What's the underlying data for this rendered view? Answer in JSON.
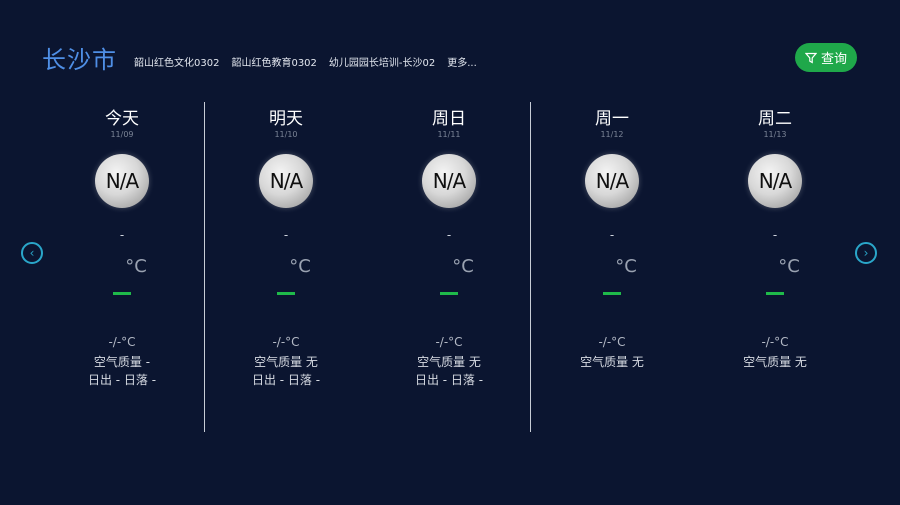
{
  "header": {
    "city": "长沙市",
    "tags": [
      "韶山红色文化0302",
      "韶山红色教育0302",
      "幼儿园园长培训-长沙02",
      "更多..."
    ],
    "query_label": "查询"
  },
  "nav": {
    "prev": "‹",
    "next": "›"
  },
  "days": [
    {
      "name": "今天",
      "date": "11/09",
      "icon": "N/A",
      "weather": "-",
      "temp_unit": "°C",
      "range": "-/-°C",
      "aqi": "空气质量 -",
      "sun": "日出 - 日落 -"
    },
    {
      "name": "明天",
      "date": "11/10",
      "icon": "N/A",
      "weather": "-",
      "temp_unit": "°C",
      "range": "-/-°C",
      "aqi": "空气质量 无",
      "sun": "日出 - 日落 -"
    },
    {
      "name": "周日",
      "date": "11/11",
      "icon": "N/A",
      "weather": "-",
      "temp_unit": "°C",
      "range": "-/-°C",
      "aqi": "空气质量 无",
      "sun": "日出 - 日落 -"
    },
    {
      "name": "周一",
      "date": "11/12",
      "icon": "N/A",
      "weather": "-",
      "temp_unit": "°C",
      "range": "-/-°C",
      "aqi": "空气质量 无",
      "sun": ""
    },
    {
      "name": "周二",
      "date": "11/13",
      "icon": "N/A",
      "weather": "-",
      "temp_unit": "°C",
      "range": "-/-°C",
      "aqi": "空气质量 无",
      "sun": ""
    }
  ],
  "colors": {
    "background": "#0b1530",
    "city": "#4f8fe6",
    "accent_green": "#1fa84a",
    "arrow": "#2aa6c9"
  }
}
